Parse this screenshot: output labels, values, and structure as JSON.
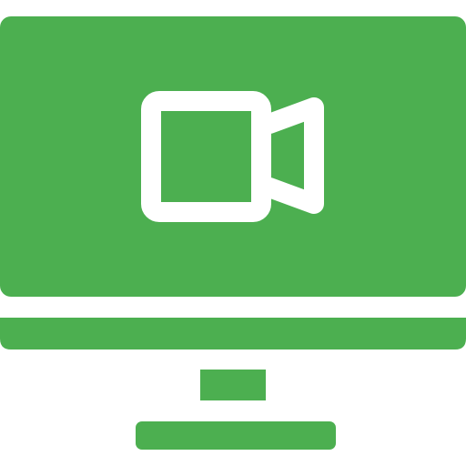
{
  "icon": {
    "name": "video-monitor-icon",
    "parts": [
      "monitor-screen",
      "monitor-bezel-strip",
      "monitor-neck",
      "monitor-base",
      "video-camera-icon"
    ]
  },
  "colors": {
    "primary": "#4CAF50",
    "foreground": "#FFFFFF",
    "background": "#FFFFFF"
  }
}
